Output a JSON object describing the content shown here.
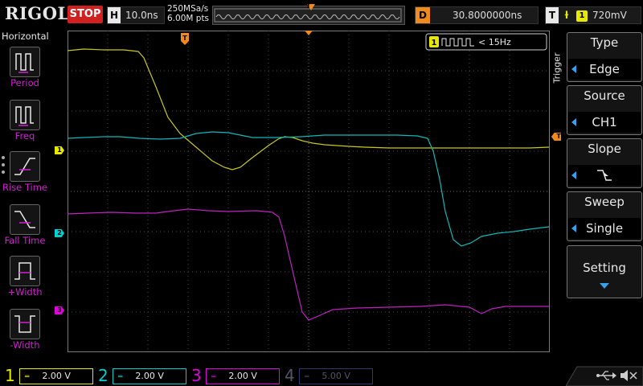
{
  "header": {
    "brand": "RIGOL",
    "run_state": "STOP",
    "horizontal_key": "H",
    "timebase": "10.0ns",
    "sample_rate": "250MSa/s",
    "memory_depth": "6.00M pts",
    "trigger_pos_marker": "T",
    "delay_key": "D",
    "delay_value": "30.8000000ns",
    "trigger_key": "T",
    "trigger_channel": "1",
    "trigger_level": "720mV"
  },
  "left_menu": {
    "title": "Horizontal",
    "items": [
      {
        "label": "Period",
        "icon": "period-icon"
      },
      {
        "label": "Freq",
        "icon": "frequency-icon"
      },
      {
        "label": "Rise Time",
        "icon": "rise-time-icon"
      },
      {
        "label": "Fall Time",
        "icon": "fall-time-icon"
      },
      {
        "label": "+Width",
        "icon": "positive-width-icon"
      },
      {
        "label": "-Width",
        "icon": "negative-width-icon"
      }
    ]
  },
  "screen": {
    "trigger_marker": "T",
    "freq_counter": {
      "channel": "1",
      "value": "< 15Hz"
    },
    "channel_markers": [
      "1",
      "2",
      "3"
    ]
  },
  "right_menu": {
    "vertical_label": "Trigger",
    "items": [
      {
        "title": "Type",
        "value": "Edge"
      },
      {
        "title": "Source",
        "value": "CH1"
      },
      {
        "title": "Slope",
        "value": ""
      },
      {
        "title": "Sweep",
        "value": "Single"
      },
      {
        "title": "Setting",
        "value": ""
      }
    ]
  },
  "channels": [
    {
      "num": "1",
      "scale": "2.00 V",
      "color": "#e8e800",
      "active": true
    },
    {
      "num": "2",
      "scale": "2.00 V",
      "color": "#00d0d0",
      "active": true
    },
    {
      "num": "3",
      "scale": "2.00 V",
      "color": "#e000e0",
      "active": true
    },
    {
      "num": "4",
      "scale": "5.00 V",
      "color": "#3a6ad0",
      "active": false
    }
  ],
  "colors": {
    "ch1": "#c8c820",
    "ch2": "#10b8b8",
    "ch3": "#c020c0",
    "accent": "#f08a1c",
    "stop": "#d02020"
  }
}
